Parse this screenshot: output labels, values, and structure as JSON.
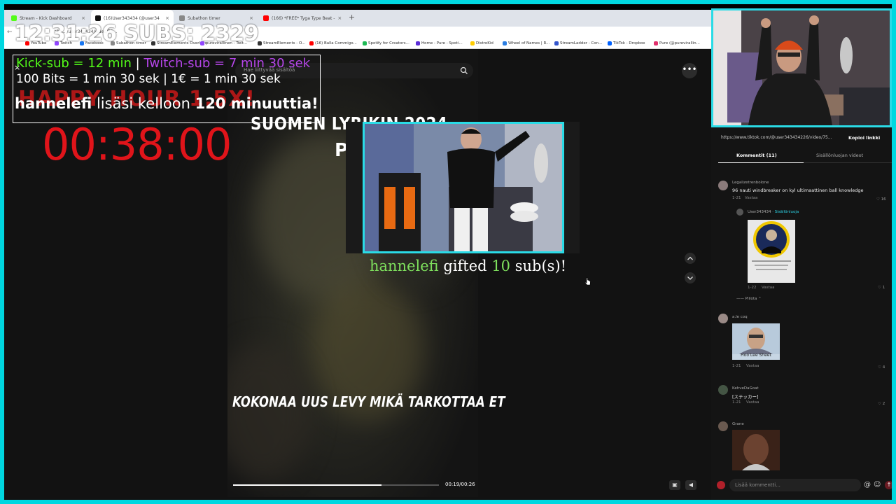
{
  "browser": {
    "tabs": [
      {
        "label": "Stream - Kick Dashboard",
        "color": "#53fc18",
        "active": false
      },
      {
        "label": "(16)User343434 (@user34",
        "color": "#111111",
        "active": true
      },
      {
        "label": "Subathon timer",
        "color": "#888888",
        "active": false
      },
      {
        "label": "(166) *FREE* Tyga Type Beat -",
        "color": "#ff0000",
        "active": false
      }
    ],
    "new_tab": "+",
    "url": "tikt... /user343434/video/75...",
    "bookmarks": [
      {
        "label": "YouTube",
        "color": "#ff0000"
      },
      {
        "label": "Twitch",
        "color": "#9146ff"
      },
      {
        "label": "Facebook",
        "color": "#1877f2"
      },
      {
        "label": "Subathon timer",
        "color": "#888888"
      },
      {
        "label": "StreamElements Overlays",
        "color": "#333333"
      },
      {
        "label": "purevirallinen - Twit...",
        "color": "#9146ff"
      },
      {
        "label": "StreamElements - O...",
        "color": "#333333"
      },
      {
        "label": "(16) Balla Commigo...",
        "color": "#ff0000"
      },
      {
        "label": "Spotify for Creators...",
        "color": "#1db954"
      },
      {
        "label": "Home - Pure - Spoti...",
        "color": "#5b2dd6"
      },
      {
        "label": "DistroKid",
        "color": "#ffcc00"
      },
      {
        "label": "Wheel of Names | R...",
        "color": "#2a7de1"
      },
      {
        "label": "StreamLadder - Con...",
        "color": "#3355cc"
      },
      {
        "label": "TikTok - Dropbox",
        "color": "#0061ff"
      },
      {
        "label": "Pure (@purevirallin...",
        "color": "#e1306c"
      }
    ]
  },
  "overlay": {
    "clock": "12:31:26",
    "subs_label": "SUBS:",
    "subs_count": "2329",
    "kick_rate": "Kick-sub = 12 min",
    "separator": "|",
    "twitch_rate": "Twitch-sub = 7 min 30 sek",
    "bits_rate": "100 Bits = 1 min 30 sek  | 1€ = 1 min 30 sek",
    "happy_hour": "HAPPY HOUR 1.5X!",
    "added_user": "hannelefi",
    "added_text": "lisäsi kelloon",
    "added_amount": "120 minuuttia!",
    "timer": "00:38:00",
    "close_glyph": "×"
  },
  "alert": {
    "user": "hannelefi",
    "action": "gifted",
    "count": "10",
    "unit": "sub(s)!"
  },
  "video": {
    "search_placeholder": "Hae liittyvää sisältöä",
    "title": "SUOMEN LYRIKIN 2024",
    "title2": "P",
    "caption": "KOKONAA UUS LEVY MIKÄ TARKOTTAA ET",
    "time": "00:19/00:26",
    "progress": 0.72,
    "more_glyph": "•••"
  },
  "comments_panel": {
    "link": "https://www.tiktok.com/@user343434226/video/75...",
    "copy_label": "Kopioi linkki",
    "tab_comments": "Kommentit (11)",
    "tab_creator_videos": "Sisällönluojan videot",
    "reply_label": "Vastaa",
    "hide_label": "Piilota ⌃",
    "creator_tag": "· Sisällönluoja",
    "input_placeholder": "Lisää kommentti...",
    "comments": [
      {
        "user": "Legalizetrenbolone",
        "text": "96 nauti windbreaker on kyl ultimaattinen ball knowledge",
        "date": "1-21",
        "likes": "16"
      },
      {
        "user": "User343434",
        "text": "",
        "date": "1-22",
        "likes": "1"
      },
      {
        "user": "a.le coq",
        "text": "",
        "sticker_caption": "Hoo Lee Sheet",
        "date": "1-21",
        "likes": "4"
      },
      {
        "user": "KehveDaGoat",
        "text": "[ステッカー]",
        "date": "1-21",
        "likes": "2"
      },
      {
        "user": "Grane",
        "text": "",
        "date": "",
        "likes": ""
      }
    ]
  },
  "colors": {
    "accent_cyan": "#2adbe6",
    "kick_green": "#53fc18",
    "twitch_purple": "#b545e8",
    "timer_red": "#e0141a",
    "alert_green": "#7ee05d"
  }
}
